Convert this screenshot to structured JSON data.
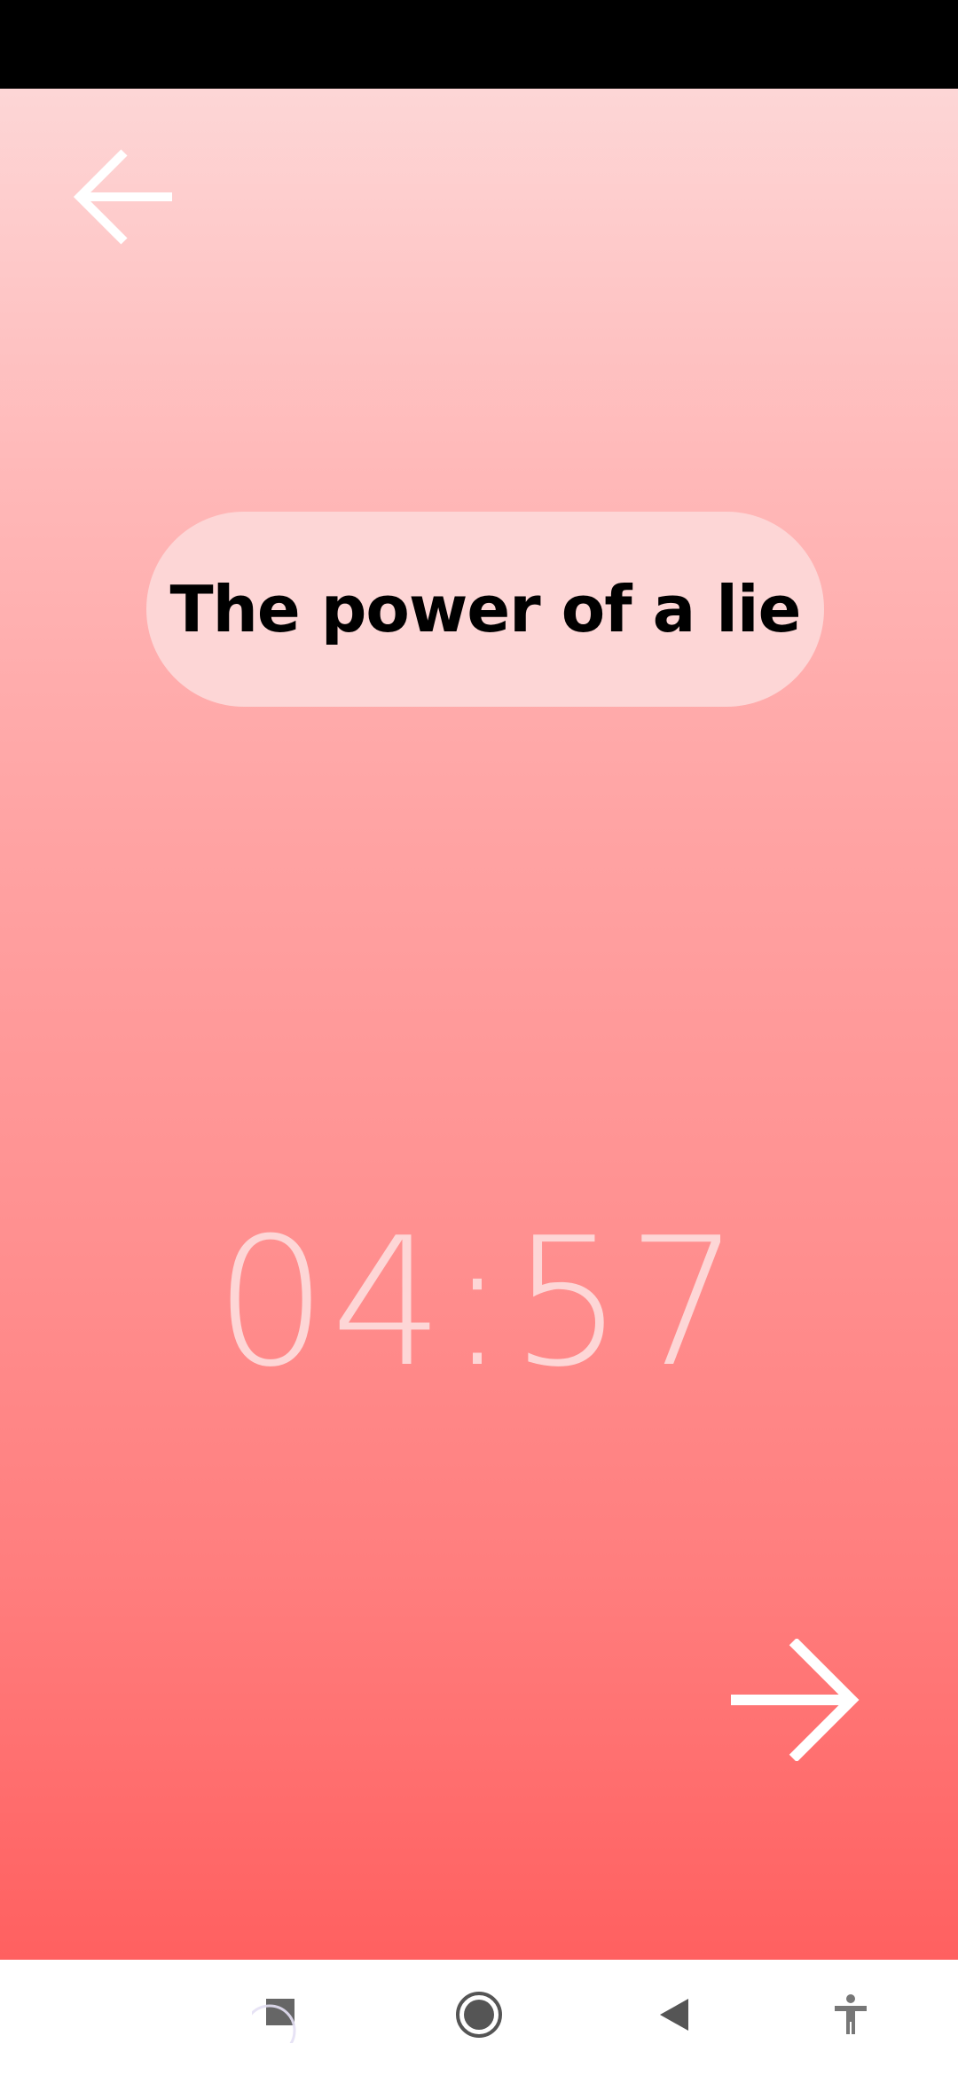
{
  "header": {
    "back_icon": "arrow-left-icon"
  },
  "title": {
    "text": "The power of a lie"
  },
  "timer": {
    "value": "04:57"
  },
  "footer": {
    "next_icon": "arrow-right-icon"
  },
  "system_nav": {
    "items": [
      {
        "icon": "recents-square-icon"
      },
      {
        "icon": "home-circle-icon"
      },
      {
        "icon": "back-triangle-icon"
      },
      {
        "icon": "accessibility-icon"
      }
    ]
  },
  "colors": {
    "gradient_top": "#fdd6d6",
    "gradient_bottom": "#ff6060",
    "pill_bg": "#fdd6d6",
    "timer_text": "#fdd6d6",
    "arrow": "#ffffff",
    "nav_icon": "#666666"
  }
}
